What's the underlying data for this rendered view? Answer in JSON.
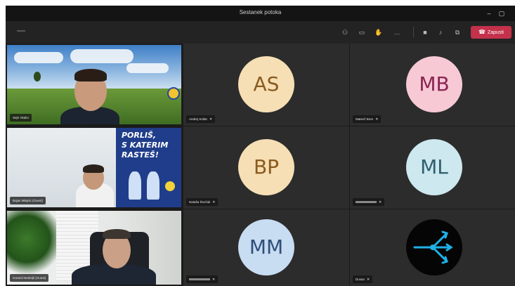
{
  "window": {
    "title": "Sestanek potoka"
  },
  "toolbar": {
    "leave_label": "Zapusti",
    "icons": [
      "participants-icon",
      "chat-icon",
      "raise-hand-icon",
      "more-icon",
      "camera-icon",
      "mic-icon",
      "share-icon"
    ]
  },
  "tiles": {
    "t1": {
      "name": "Sejtr Vitalni",
      "poster_lines": []
    },
    "t2": {
      "name": "Andrej Sotlar",
      "initials": "AS",
      "avatar_bg": "#f6dfb5",
      "avatar_fg": "#8a5a1e"
    },
    "t3": {
      "name": "Matevž Bren",
      "initials": "MB",
      "avatar_bg": "#f7c9d4",
      "avatar_fg": "#8b2452"
    },
    "t4": {
      "name": "Bojan Mlejnic (Guest)",
      "poster_lines": [
        "PORLIŠ,",
        "S KATERIM",
        "RASTEŠ!"
      ]
    },
    "t5": {
      "name": "Nataša Ševčak",
      "initials": "BP",
      "avatar_bg": "#f6dfb5",
      "avatar_fg": "#8a5a1e"
    },
    "t6": {
      "name": "",
      "initials": "ML",
      "avatar_bg": "#cde8ef",
      "avatar_fg": "#2f5f6e"
    },
    "t7": {
      "name": "Gorazd Nedeljk (Guest)"
    },
    "t8": {
      "name": "",
      "initials": "MM",
      "avatar_bg": "#c8dcf2",
      "avatar_fg": "#2f4f7a"
    },
    "t9": {
      "name": "Dusan"
    }
  },
  "colors": {
    "leave": "#c4314b",
    "tile_bg": "#2c2c2c",
    "window_bg": "#1b1b1b"
  }
}
